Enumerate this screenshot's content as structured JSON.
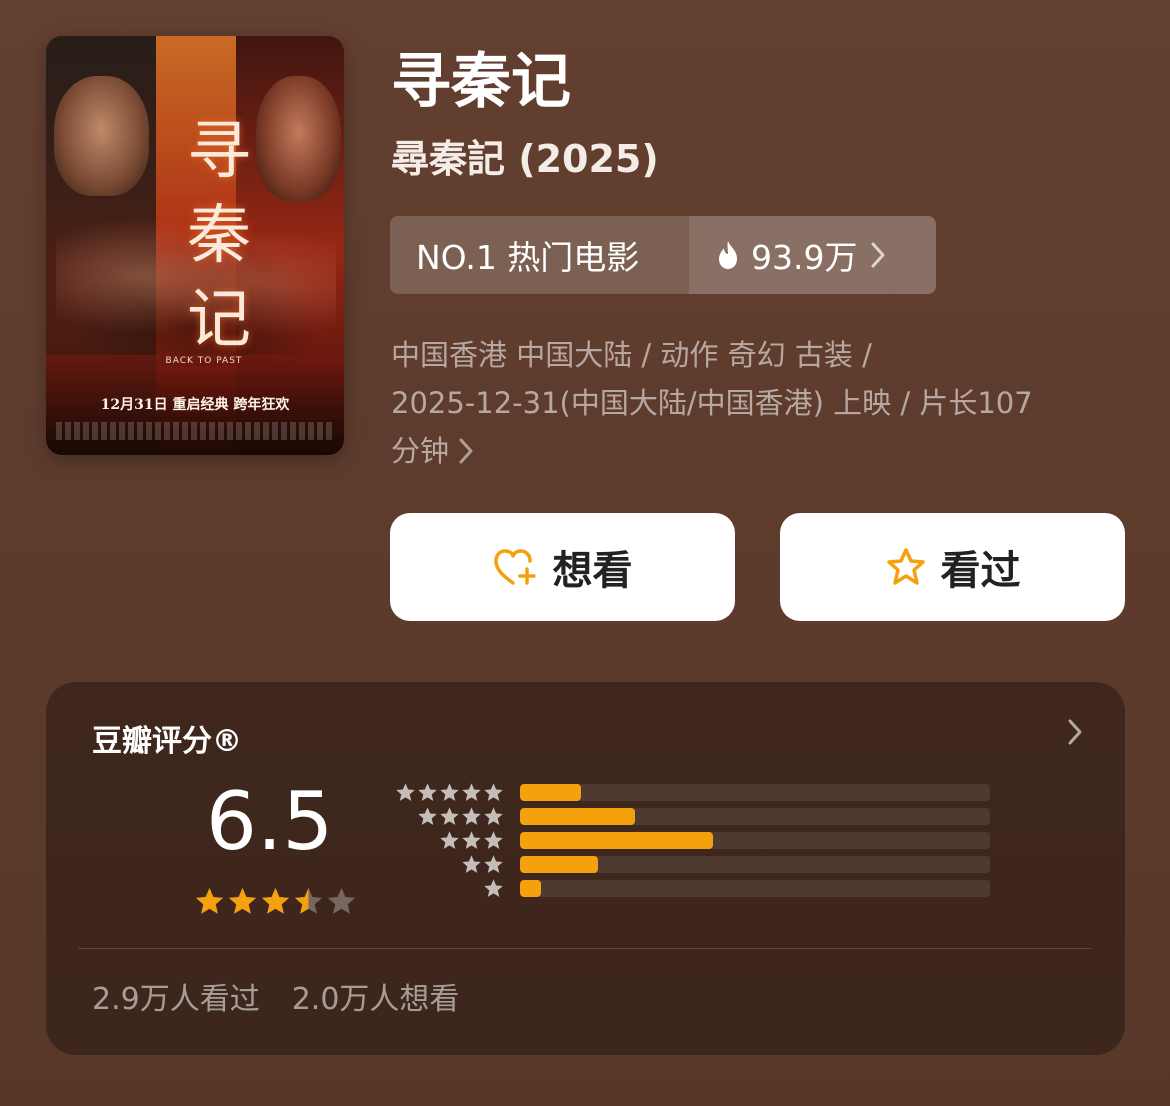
{
  "movie": {
    "title": "寻秦记",
    "subtitle": "尋秦記 (2025)",
    "poster": {
      "title_glyphs": [
        "寻",
        "秦",
        "记"
      ],
      "tagline_en": "BACK TO PAST",
      "date_line": "12月31日 重启经典 跨年狂欢"
    }
  },
  "rank": {
    "label": "NO.1 热门电影",
    "heat": "93.9万",
    "heat_icon": "flame-icon",
    "chevron_icon": "chevron-right-icon"
  },
  "meta": {
    "line1": "中国香港 中国大陆 / 动作 奇幻 古装 /",
    "line2": "2025-12-31(中国大陆/中国香港) 上映 / 片长107",
    "line3": "分钟"
  },
  "actions": {
    "want_label": "想看",
    "want_icon": "heart-plus-icon",
    "seen_label": "看过",
    "seen_icon": "star-outline-icon",
    "accent": "#f5a10e"
  },
  "rating": {
    "title": "豆瓣评分®",
    "score": "6.5",
    "stars_filled": 3.5,
    "stars_total": 5,
    "distribution": [
      {
        "stars": 5,
        "fraction": 0.13
      },
      {
        "stars": 4,
        "fraction": 0.245
      },
      {
        "stars": 3,
        "fraction": 0.41
      },
      {
        "stars": 2,
        "fraction": 0.165
      },
      {
        "stars": 1,
        "fraction": 0.045
      }
    ],
    "bar_color": "#f5a10e",
    "seen_count": "2.9万人看过",
    "want_count": "2.0万人想看"
  }
}
